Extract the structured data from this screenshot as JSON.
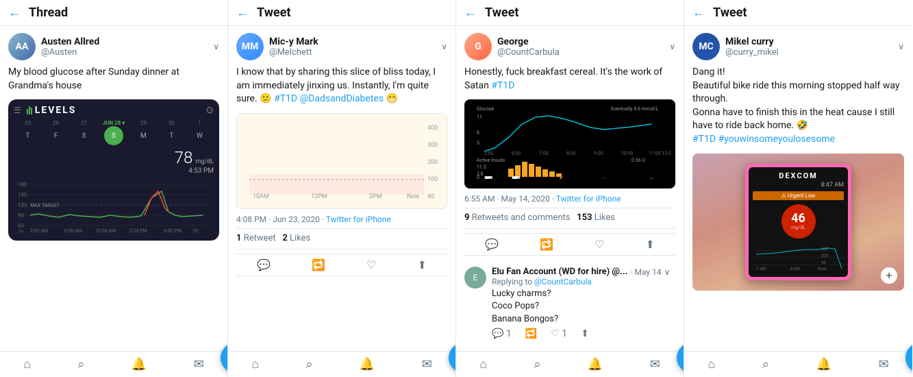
{
  "panels": [
    {
      "id": "panel1",
      "header_type": "Thread",
      "header_title": "Thread",
      "user": {
        "name": "Austen Allred",
        "handle": "@Austen",
        "avatar_initials": "AA",
        "avatar_color": "#4a6a8a"
      },
      "tweet_text": "My blood glucose after Sunday dinner at Grandma's house",
      "has_levels_chart": true,
      "levels": {
        "title": "LEVELS",
        "glucose_value": "78",
        "glucose_unit": "mg/dL",
        "glucose_time": "4:53 PM",
        "days": [
          {
            "label": "25",
            "letter": "T",
            "active": false
          },
          {
            "label": "26",
            "letter": "F",
            "active": false
          },
          {
            "label": "27",
            "letter": "S",
            "active": false
          },
          {
            "label": "JUN 28",
            "letter": "S",
            "active": true,
            "selected": true
          },
          {
            "label": "29",
            "letter": "M",
            "active": false
          },
          {
            "label": "30",
            "letter": "T",
            "active": false
          },
          {
            "label": "1",
            "letter": "W",
            "active": false
          }
        ],
        "y_labels": [
          "180",
          "150",
          "120",
          "90",
          "60",
          "30"
        ],
        "x_labels": [
          "2:00 AM",
          "6:00 AM",
          "10:00 AM",
          "2:00 PM",
          "6:00 PM",
          "10:"
        ]
      },
      "nav": [
        "home",
        "search",
        "bell",
        "mail"
      ]
    },
    {
      "id": "panel2",
      "header_type": "Tweet",
      "header_title": "Tweet",
      "user": {
        "name": "Mic-y Mark",
        "handle": "@Melchett",
        "avatar_initials": "MM",
        "avatar_color": "#3388ff"
      },
      "tweet_text": "I know that by sharing this slice of bliss today, I am immediately jinxing us. Instantly, I'm quite sure. 🙁 #T1D @DadsandDiabetes 😁",
      "has_chart": true,
      "meta": "4:08 PM · Jun 23, 2020 · Twitter for iPhone",
      "stats": {
        "retweets": "1 Retweet",
        "likes": "2 Likes"
      },
      "nav": [
        "home",
        "search",
        "bell",
        "mail"
      ]
    },
    {
      "id": "panel3",
      "header_type": "Tweet",
      "header_title": "Tweet",
      "user": {
        "name": "George",
        "handle": "@CountCarbula",
        "avatar_initials": "G",
        "avatar_color": "#e07040"
      },
      "tweet_text": "Honestly, fuck breakfast cereal. It's the work of Satan #T1D",
      "has_glucose_chart": true,
      "meta": "6:55 AM · May 14, 2020 · Twitter for iPhone",
      "stats": {
        "retweets": "9",
        "retweet_label": "Retweets and comments",
        "likes": "153",
        "like_label": "Likes"
      },
      "reply": {
        "name": "Elu Fan Account (WD for hire) @...",
        "date": "May 14",
        "avatar_initials": "E",
        "avatar_color": "#888",
        "reply_to": "@CountCarbula",
        "text": "Lucky charms?\nCoco Pops?\nBanana Bongos?",
        "likes": "1"
      },
      "nav": [
        "home",
        "search",
        "bell",
        "mail"
      ]
    },
    {
      "id": "panel4",
      "header_type": "Tweet",
      "header_title": "Tweet",
      "user": {
        "name": "Mikel curry",
        "handle": "@curry_mikel",
        "avatar_initials": "MC",
        "avatar_color": "#2255aa"
      },
      "tweet_text": "Dang it!\nBeautiful bike ride this morning stopped half way through.\nGonna have to finish this in the heat cause I still have to ride back home. 🤣\n#T1D #youwinsomeyoulosesome",
      "has_dexcom": true,
      "nav": [
        "home",
        "search",
        "bell",
        "mail"
      ]
    }
  ]
}
